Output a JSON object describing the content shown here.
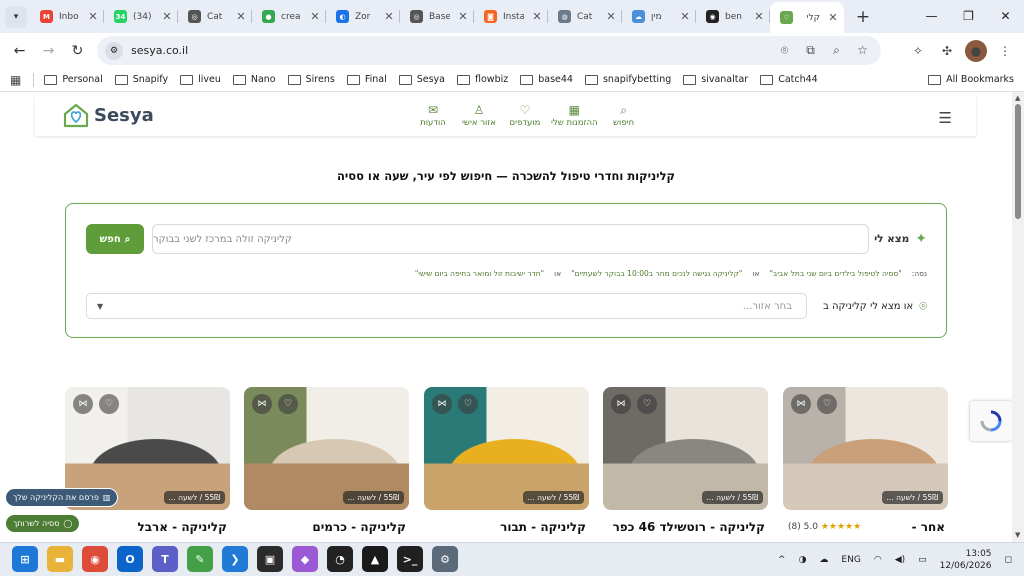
{
  "browser": {
    "tabs": [
      {
        "title": "Inbo",
        "favicon": "gmail-icon",
        "color": "#ea4335",
        "glyph": "M"
      },
      {
        "title": "(34)",
        "favicon": "whatsapp-icon",
        "color": "#25d366",
        "glyph": "34"
      },
      {
        "title": "Cat",
        "favicon": "openai-icon",
        "color": "#555555",
        "glyph": "◎"
      },
      {
        "title": "crea",
        "favicon": "green-circle-icon",
        "color": "#34a853",
        "glyph": "●"
      },
      {
        "title": "Zor",
        "favicon": "globe-icon",
        "color": "#1a73e8",
        "glyph": "◐"
      },
      {
        "title": "Base",
        "favicon": "openai-icon",
        "color": "#555555",
        "glyph": "◎"
      },
      {
        "title": "Insta",
        "favicon": "instapage-icon",
        "color": "#f26522",
        "glyph": "◙"
      },
      {
        "title": "Cat",
        "favicon": "globe-icon",
        "color": "#6b7b8c",
        "glyph": "◍"
      },
      {
        "title": "מין",
        "favicon": "cloud-icon",
        "color": "#4a90d9",
        "glyph": "☁"
      },
      {
        "title": "ben",
        "favicon": "github-icon",
        "color": "#222222",
        "glyph": "◉"
      },
      {
        "title": "קלי",
        "favicon": "sesya-icon",
        "color": "#6aa84f",
        "glyph": "♡"
      }
    ],
    "url": "sesya.co.il",
    "bookmarks": [
      "Personal",
      "Snapify",
      "liveu",
      "Nano",
      "Sirens",
      "Final",
      "Sesya",
      "flowbiz",
      "base44",
      "snapifybetting",
      "sivanaltar",
      "Catch44"
    ],
    "all_bookmarks": "All Bookmarks"
  },
  "site": {
    "logo": "Sesya",
    "nav": [
      {
        "label": "חיפוש",
        "icon": "search-icon",
        "glyph": "⌕"
      },
      {
        "label": "ההזמנות שלי",
        "icon": "calendar-icon",
        "glyph": "▦"
      },
      {
        "label": "מועדפים",
        "icon": "heart-icon",
        "glyph": "♡"
      },
      {
        "label": "אזור אישי",
        "icon": "user-icon",
        "glyph": "♙"
      },
      {
        "label": "הודעות",
        "icon": "mail-icon",
        "glyph": "✉"
      }
    ],
    "headline": "קליניקות וחדרי טיפול להשכרה — חיפוש לפי עיר, שעה או ססיה"
  },
  "search": {
    "label": "מצא לי",
    "placeholder": "קליניקה זולה במרכז לשני בבוקר",
    "button": "חפש",
    "examples_prefix": "נסה:",
    "examples": [
      "\"ססיה לטיפול בילדים ביום שני בתל אביב\"",
      "\"קליניקה נגישה לנכים מחר ב10:00 בבוקר לשעתיים\"",
      "\"חדר ישיבות זול ומואר בחיפה ביום שישי\""
    ],
    "or": "או",
    "region_label": "או מצא לי קליניקה ב",
    "region_placeholder": "בחר אזור..."
  },
  "cards": [
    {
      "title": "אחר -",
      "price": "55₪ / לשעה ...",
      "rating": "(8)",
      "score": "5.0",
      "stars": "★★★★★",
      "palette": [
        "#b8b2aa",
        "#ece6de",
        "#c9a07a",
        "#d5c8b8"
      ]
    },
    {
      "title": "קליניקה - רוטשילד 46 כפר",
      "price": "55₪ / לשעה ...",
      "palette": [
        "#6e6a64",
        "#e8e4dc",
        "#8a8682",
        "#c2b8a8"
      ]
    },
    {
      "title": "קליניקה - תבור",
      "price": "55₪ / לשעה ...",
      "palette": [
        "#2a7a78",
        "#f2eee6",
        "#e8b020",
        "#caa36a"
      ]
    },
    {
      "title": "קליניקה - כרמים",
      "price": "55₪ / לשעה ...",
      "palette": [
        "#7a8a5a",
        "#f1eee8",
        "#d6c8b2",
        "#b08a62"
      ]
    },
    {
      "title": "קליניקה - ארבל",
      "price": "55₪ / לשעה ...",
      "palette": [
        "#f2f0ec",
        "#e8e6e2",
        "#4a4a4a",
        "#c8a27a"
      ]
    }
  ],
  "floating": {
    "publish": "פרסם את הקליניקה שלך",
    "session": "ססיה לשרותך"
  },
  "taskbar": {
    "apps": [
      {
        "name": "start-button",
        "glyph": "⊞",
        "color": "#1e78d7"
      },
      {
        "name": "file-explorer-icon",
        "glyph": "▬",
        "color": "#e8b338"
      },
      {
        "name": "chrome-icon",
        "glyph": "◉",
        "color": "#dd4b39"
      },
      {
        "name": "outlook-icon",
        "glyph": "O",
        "color": "#0a64c9"
      },
      {
        "name": "teams-icon",
        "glyph": "T",
        "color": "#5b5fc7"
      },
      {
        "name": "notepad-icon",
        "glyph": "✎",
        "color": "#43a047"
      },
      {
        "name": "vscode-icon",
        "glyph": "❯",
        "color": "#1f7bd6"
      },
      {
        "name": "claude-code-icon",
        "glyph": "▣",
        "color": "#2b2b2b"
      },
      {
        "name": "figma-icon",
        "glyph": "◆",
        "color": "#9b59d6"
      },
      {
        "name": "github-desktop-icon",
        "glyph": "◔",
        "color": "#222222"
      },
      {
        "name": "cursor-icon",
        "glyph": "▲",
        "color": "#1a1a1a"
      },
      {
        "name": "terminal-icon",
        "glyph": ">_",
        "color": "#202020"
      },
      {
        "name": "settings-icon",
        "glyph": "⚙",
        "color": "#5a6a7a"
      }
    ],
    "language": "ENG",
    "time": "13:05",
    "date": "12/06/2026"
  }
}
